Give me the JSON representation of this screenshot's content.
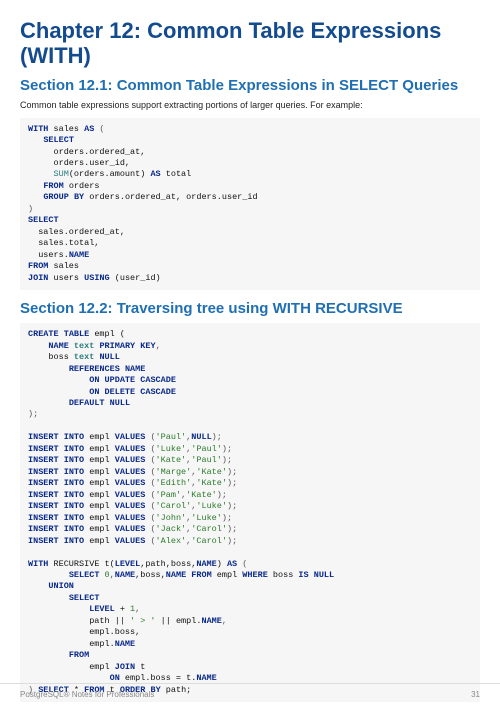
{
  "chapter": {
    "title": "Chapter 12: Common Table Expressions (WITH)"
  },
  "sections": {
    "s1": {
      "heading": "Section 12.1: Common Table Expressions in SELECT Queries",
      "intro": "Common table expressions support extracting portions of larger queries. For example:"
    },
    "s2": {
      "heading": "Section 12.2: Traversing tree using WITH RECURSIVE"
    }
  },
  "code": {
    "block1": {
      "t1": "WITH",
      "t2": " sales ",
      "t3": "AS",
      "t4": " (",
      "t5": "   ",
      "t6": "SELECT",
      "t7": "     orders.ordered_at,",
      "t8": "     orders.user_id,",
      "t9": "     ",
      "t10": "SUM",
      "t11": "(orders.amount) ",
      "t12": "AS",
      "t13": " total",
      "t14": "   ",
      "t15": "FROM",
      "t16": " orders",
      "t17": "   ",
      "t18": "GROUP",
      "t19": " ",
      "t20": "BY",
      "t21": " orders.ordered_at, orders.user_id",
      "t22": ")",
      "t23": "SELECT",
      "t24": "  sales.ordered_at,",
      "t25": "  sales.total,",
      "t26": "  users.",
      "t27": "NAME",
      "t28": "FROM",
      "t29": " sales",
      "t30": "JOIN",
      "t31": " users ",
      "t32": "USING",
      "t33": " (user_id)"
    },
    "block2": {
      "a1": "CREATE",
      "a2": " ",
      "a3": "TABLE",
      "a4": " empl (",
      "a5": "    ",
      "a6": "NAME",
      "a7": " ",
      "a8": "text",
      "a9": " ",
      "a10": "PRIMARY",
      "a11": " ",
      "a12": "KEY",
      "a13": ",",
      "a14": "    boss ",
      "a15": "text",
      "a16": " ",
      "a17": "NULL",
      "a18": "        ",
      "a19": "REFERENCES",
      "a20": " ",
      "a21": "NAME",
      "a22": "            ",
      "a23": "ON",
      "a24": " ",
      "a25": "UPDATE",
      "a26": " ",
      "a27": "CASCADE",
      "a28": "            ",
      "a29": "ON",
      "a30": " ",
      "a31": "DELETE",
      "a32": " ",
      "a33": "CASCADE",
      "a34": "        ",
      "a35": "DEFAULT",
      "a36": " ",
      "a37": "NULL",
      "a38": ");",
      "ins": "INSERT",
      "into": " ",
      "into2": "INTO",
      "emplv": " empl ",
      "vals": "VALUES",
      "sp": " (",
      "cm": ",",
      "cp": ");",
      "nul": "NULL",
      "v1a": "'Paul'",
      "v2a": "'Luke'",
      "v2b": "'Paul'",
      "v3a": "'Kate'",
      "v3b": "'Paul'",
      "v4a": "'Marge'",
      "v4b": "'Kate'",
      "v5a": "'Edith'",
      "v5b": "'Kate'",
      "v6a": "'Pam'",
      "v6b": "'Kate'",
      "v7a": "'Carol'",
      "v7b": "'Luke'",
      "v8a": "'John'",
      "v8b": "'Luke'",
      "v9a": "'Jack'",
      "v9b": "'Carol'",
      "v10a": "'Alex'",
      "v10b": "'Carol'",
      "r1": "WITH",
      "r2": " RECURSIVE t(",
      "r3": "LEVEL",
      "r4": ",path,boss,",
      "r5": "NAME",
      "r6": ") ",
      "r7": "AS",
      "r8": " (",
      "r9": "        ",
      "r10": "SELECT",
      "r11": " ",
      "r12": "0",
      "r13": ",",
      "r14": "NAME",
      "r15": ",boss,",
      "r16": "NAME",
      "r17": " ",
      "r18": "FROM",
      "r19": " empl ",
      "r20": "WHERE",
      "r21": " boss ",
      "r22": "IS",
      "r23": " ",
      "r24": "NULL",
      "r25": "    ",
      "r26": "UNION",
      "r27": "        ",
      "r28": "SELECT",
      "r29": "            ",
      "r30": "LEVEL",
      "r31": " + ",
      "r32": "1",
      "r33": ",",
      "r34": "            path || ",
      "r35": "' > '",
      "r36": " || empl.",
      "r37": "NAME",
      "r38": ",",
      "r39": "            empl.boss,",
      "r40": "            empl.",
      "r41": "NAME",
      "r42": "        ",
      "r43": "FROM",
      "r44": "            empl ",
      "r45": "JOIN",
      "r46": " t",
      "r47": "                ",
      "r48": "ON",
      "r49": " empl.boss = t.",
      "r50": "NAME",
      "r51": ") ",
      "r52": "SELECT",
      "r53": " * ",
      "r54": "FROM",
      "r55": " t ",
      "r56": "ORDER",
      "r57": " ",
      "r58": "BY",
      "r59": " path;"
    }
  },
  "footer": {
    "left": "PostgreSQL® Notes for Professionals",
    "right": "31"
  }
}
